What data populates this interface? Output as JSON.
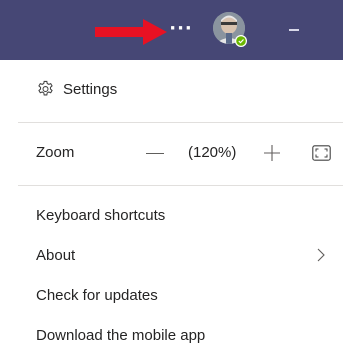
{
  "titlebar": {
    "background": "#464775",
    "more_label": "···",
    "avatar_status": "available",
    "status_color": "#6bb700"
  },
  "menu": {
    "settings": {
      "label": "Settings",
      "icon": "gear-icon"
    },
    "zoom": {
      "label": "Zoom",
      "minus_label": "—",
      "value": "(120%)",
      "plus_icon": "plus-icon",
      "fullscreen_icon": "fullscreen-icon"
    },
    "items": [
      {
        "label": "Keyboard shortcuts"
      },
      {
        "label": "About",
        "has_submenu": true
      },
      {
        "label": "Check for updates"
      },
      {
        "label": "Download the mobile app"
      }
    ]
  },
  "annotation": {
    "arrow_color": "#e81123"
  }
}
